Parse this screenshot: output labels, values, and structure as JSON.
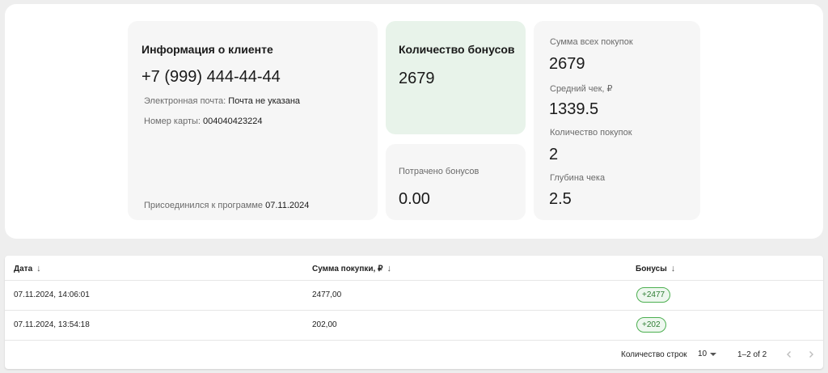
{
  "client_info": {
    "title": "Информация о клиенте",
    "phone": "+7 (999) 444-44-44",
    "email_label": "Электронная почта:",
    "email_value": "Почта не указана",
    "card_label": "Номер карты:",
    "card_value": "004040423224",
    "joined_label": "Присоединился к программе",
    "joined_value": "07.11.2024"
  },
  "bonus": {
    "title": "Количество бонусов",
    "value": "2679"
  },
  "spent": {
    "label": "Потрачено бонусов",
    "value": "0.00"
  },
  "stats": {
    "items": [
      {
        "label": "Сумма всех покупок",
        "value": "2679"
      },
      {
        "label": "Средний чек, ₽",
        "value": "1339.5"
      },
      {
        "label": "Количество покупок",
        "value": "2"
      },
      {
        "label": "Глубина чека",
        "value": "2.5"
      }
    ]
  },
  "table": {
    "columns": [
      "Дата",
      "Сумма покупки, ₽",
      "Бонусы"
    ],
    "rows": [
      {
        "date": "07.11.2024, 14:06:01",
        "amount": "2477,00",
        "bonus": "+2477"
      },
      {
        "date": "07.11.2024, 13:54:18",
        "amount": "202,00",
        "bonus": "+202"
      }
    ],
    "footer": {
      "rows_label": "Количество строк",
      "rows_value": "10",
      "range": "1–2 of 2"
    }
  },
  "colors": {
    "bonus_card_bg": "#e8f3ea",
    "chip_border": "#4caf50",
    "chip_text": "#2e7d32"
  }
}
